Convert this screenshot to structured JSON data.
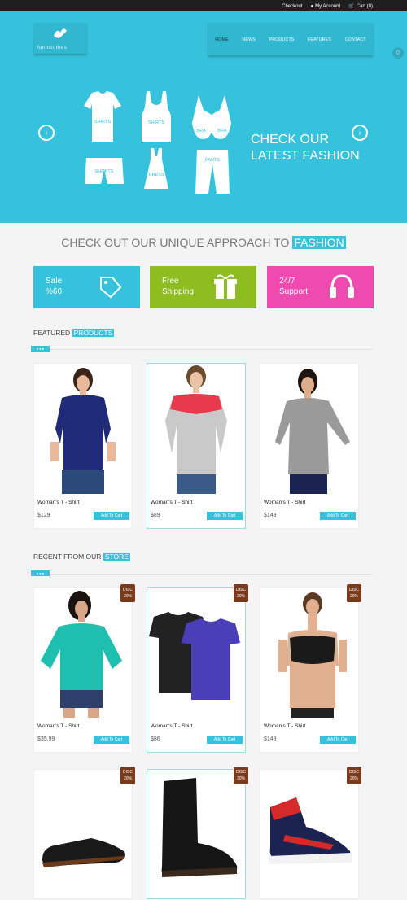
{
  "topbar": {
    "checkout": "Checkout",
    "account": "My Account",
    "cart": "Cart (0)"
  },
  "logo": {
    "text": "funnclothes"
  },
  "nav": {
    "items": [
      "HOME",
      "NEWS",
      "PRODUCTS",
      "FEATURES",
      "CONTACT"
    ]
  },
  "hero": {
    "line1": "CHECK OUR",
    "line2": "LATEST FASHION",
    "labels": {
      "shirts1": "SHIRTS",
      "shirts2": "SHIRTS",
      "bra1": "BRA",
      "bra2": "BRA",
      "shorts": "SHORTS",
      "dress": "DRESS",
      "pants": "PANTS"
    }
  },
  "approach": {
    "pre": "CHECK OUT OUR UNIQUE APPROACH TO",
    "highlight": "FASHION"
  },
  "features": [
    {
      "line1": "Sale",
      "line2": "%60",
      "color": "#36c2dc"
    },
    {
      "line1": "Free",
      "line2": "Shipping",
      "color": "#8dbd1f"
    },
    {
      "line1": "24/7",
      "line2": "Support",
      "color": "#ee4aaf"
    }
  ],
  "featured": {
    "pre": "FEATURED",
    "highlight": "PRODUCTS"
  },
  "recent": {
    "pre": "RECENT FROM OUR",
    "highlight": "STORE"
  },
  "products": [
    {
      "name": "Woman's T - Shirt",
      "price": "$129",
      "add": "Add To Cart"
    },
    {
      "name": "Woman's T - Shirt",
      "price": "$89",
      "add": "Add To Cart"
    },
    {
      "name": "Woman's T - Shirt",
      "price": "$149",
      "add": "Add To Cart"
    }
  ],
  "recent_products": [
    {
      "name": "Woman's T - Shirt",
      "price": "$35.99",
      "add": "Add To Cart",
      "tag1": "DISC",
      "tag2": "20%"
    },
    {
      "name": "Woman's T - Shirt",
      "price": "$86",
      "add": "Add To Cart",
      "tag1": "DISC",
      "tag2": "20%"
    },
    {
      "name": "Woman's T - Shirt",
      "price": "$149",
      "add": "Add To Cart",
      "tag1": "DISC",
      "tag2": "20%"
    }
  ],
  "shoe_tags": [
    {
      "tag1": "DISC",
      "tag2": "20%"
    },
    {
      "tag1": "DISC",
      "tag2": "20%"
    },
    {
      "tag1": "DISC",
      "tag2": "20%"
    }
  ]
}
